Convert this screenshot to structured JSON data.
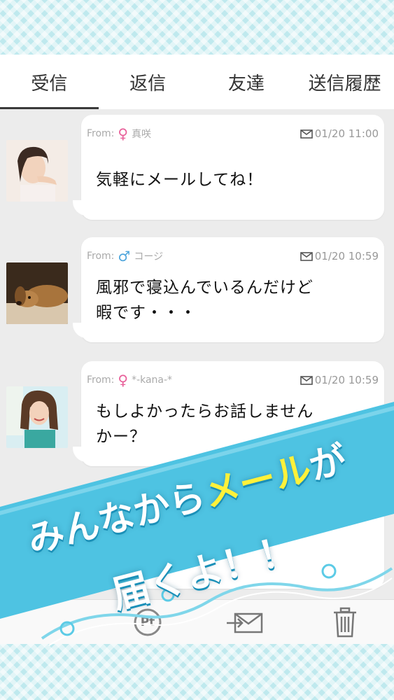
{
  "tabs": [
    {
      "label": "受信",
      "active": true
    },
    {
      "label": "返信",
      "active": false
    },
    {
      "label": "友達",
      "active": false
    },
    {
      "label": "送信履歴",
      "active": false
    }
  ],
  "messages": [
    {
      "from_prefix": "From:",
      "gender": "female",
      "gender_symbol": "♀",
      "sender": "真咲",
      "date": "01/20 11:00",
      "lines": [
        "気軽にメールしてね！"
      ],
      "avatar": "photo-woman-1"
    },
    {
      "from_prefix": "From:",
      "gender": "male",
      "gender_symbol": "♂",
      "sender": "コージ",
      "date": "01/20 10:59",
      "lines": [
        "風邪で寝込んでいるんだけど",
        "暇です・・・"
      ],
      "avatar": "photo-dog"
    },
    {
      "from_prefix": "From:",
      "gender": "female",
      "gender_symbol": "♀",
      "sender": "*-kana-*",
      "date": "01/20 10:59",
      "lines": [
        "もしよかったらお話しません",
        "かー？"
      ],
      "avatar": "photo-woman-2"
    }
  ],
  "banner": {
    "line1_pre": "みんなから",
    "line1_highlight": "メール",
    "line1_post": "が",
    "line2": "届くよ！！"
  },
  "toolbar": {
    "icons": [
      "points-icon",
      "send-mail-icon",
      "trash-icon"
    ],
    "points_label": "Pt"
  },
  "colors": {
    "banner": "#44bfe0",
    "highlight": "#fff13a",
    "female": "#e8609a",
    "male": "#4fa6dc"
  }
}
